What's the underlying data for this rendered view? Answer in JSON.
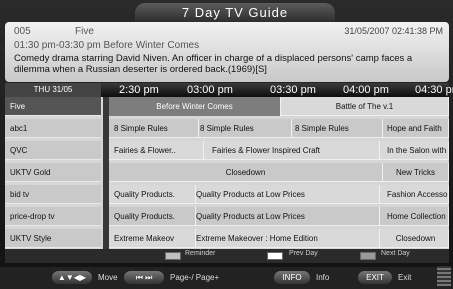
{
  "title": "7 Day TV Guide",
  "info": {
    "channel_number": "005",
    "channel_name": "Five",
    "datetime": "31/05/2007 02:41:38 PM",
    "programme_line": "01:30 pm-03:30 pm  Before Winter Comes",
    "description": "Comedy drama starring David Niven. An officer in charge of a displaced persons' camp faces a dilemma when a Russian deserter is ordered back.(1969)[S]"
  },
  "timebar": {
    "date": "THU  31/05",
    "times": [
      "2:30 pm",
      "03:00 pm",
      "03:30 pm",
      "04:00 pm",
      "04:30 pm"
    ]
  },
  "channels": [
    "Five",
    "abc1",
    "QVC",
    "UKTV Gold",
    "bid tv",
    "price-drop tv",
    "UKTV Style"
  ],
  "rows": [
    [
      "Before Winter Comes",
      "Battle of The v.1"
    ],
    [
      "8 Simple Rules",
      "8 Simple Rules",
      "8 Simple Rules",
      "Hope and Faith"
    ],
    [
      "Fairies & Flower..",
      "Fairies & Flower Inspired Craft",
      "In the Salon with"
    ],
    [
      "Closedown",
      "New Tricks"
    ],
    [
      "Quality Products.",
      "Quality Products at Low Prices",
      "Fashion Accesso"
    ],
    [
      "Quality Products.",
      "Quality Products at Low Prices",
      "Home Collection"
    ],
    [
      "Extreme Makeov",
      "Extreme Makeover : Home  Edition",
      "Closedown"
    ]
  ],
  "legend": {
    "reminder": "Reminder",
    "prev_day": "Prev Day",
    "next_day": "Next Day"
  },
  "footer": {
    "move": "Move",
    "page": "Page-/ Page+",
    "info_btn": "INFO",
    "info_lbl": "Info",
    "exit_btn": "EXIT",
    "exit_lbl": "Exit"
  },
  "colors": {
    "selected": "#555555",
    "highlight": "#7d7d7d",
    "prev_day_swatch": "#ffffff",
    "next_day_swatch": "#9a9a9a",
    "reminder_swatch": "#bfbfbf"
  }
}
